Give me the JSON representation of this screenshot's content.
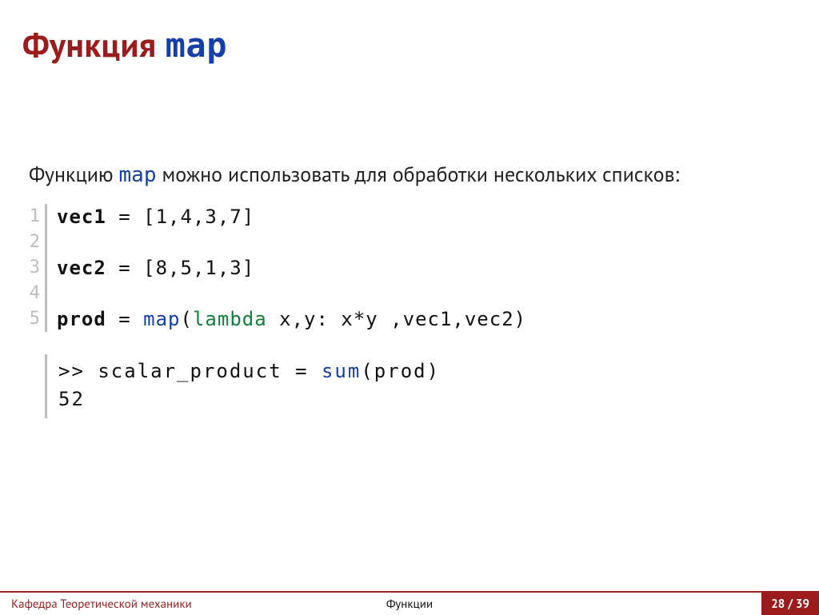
{
  "title": {
    "prefix": "Функция ",
    "mono": "map"
  },
  "intro": {
    "pre": "Функцию ",
    "mono": "map",
    "post": " можно использовать для обработки нескольких списков:"
  },
  "code": {
    "ln1": "1",
    "ln2": "2",
    "ln3": "3",
    "ln4": "4",
    "ln5": "5",
    "l1_var": "vec1",
    "l1_rest": " = [1,4,3,7]",
    "l3_var": "vec2",
    "l3_rest": " = [8,5,1,3]",
    "l5_var": "prod",
    "l5_eq": " = ",
    "l5_map": "map",
    "l5_open": "(",
    "l5_lambda": "lambda",
    "l5_args": " x,y: x*y ,vec1,vec2)"
  },
  "output": {
    "line1_pre": ">> scalar_product = ",
    "line1_func": "sum",
    "line1_post": "(prod)",
    "line2": "52"
  },
  "footer": {
    "dept": "Кафедра Теоретической механики",
    "center": "Функции",
    "pager": "28 / 39"
  }
}
